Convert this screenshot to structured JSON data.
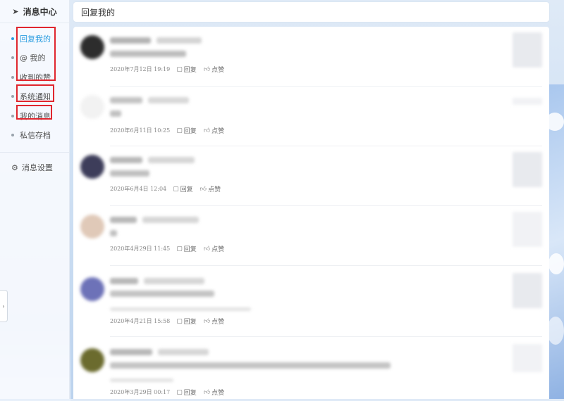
{
  "sidebar": {
    "title": "消息中心",
    "items": [
      {
        "label": "回复我的"
      },
      {
        "label": "@ 我的"
      },
      {
        "label": "收到的赞"
      },
      {
        "label": "系统通知"
      },
      {
        "label": "我的消息"
      },
      {
        "label": "私信存档"
      }
    ],
    "settings_label": "消息设置"
  },
  "header": {
    "title": "回复我的"
  },
  "actions": {
    "reply": "回复",
    "like": "点赞"
  },
  "messages": [
    {
      "date": "2020年7月12日 19:19"
    },
    {
      "date": "2020年6月11日 10:25"
    },
    {
      "date": "2020年6月4日 12:04"
    },
    {
      "date": "2020年4月29日 11:45"
    },
    {
      "date": "2020年4月21日 15:58"
    },
    {
      "date": "2020年3月29日 00:17"
    }
  ],
  "colors": {
    "accent": "#2b9de0",
    "highlight_box": "#e0262e"
  },
  "icons": {
    "title": "paper-plane-icon",
    "settings": "gear-icon",
    "reply": "speech-bubble-icon",
    "like": "thumbs-up-icon"
  }
}
